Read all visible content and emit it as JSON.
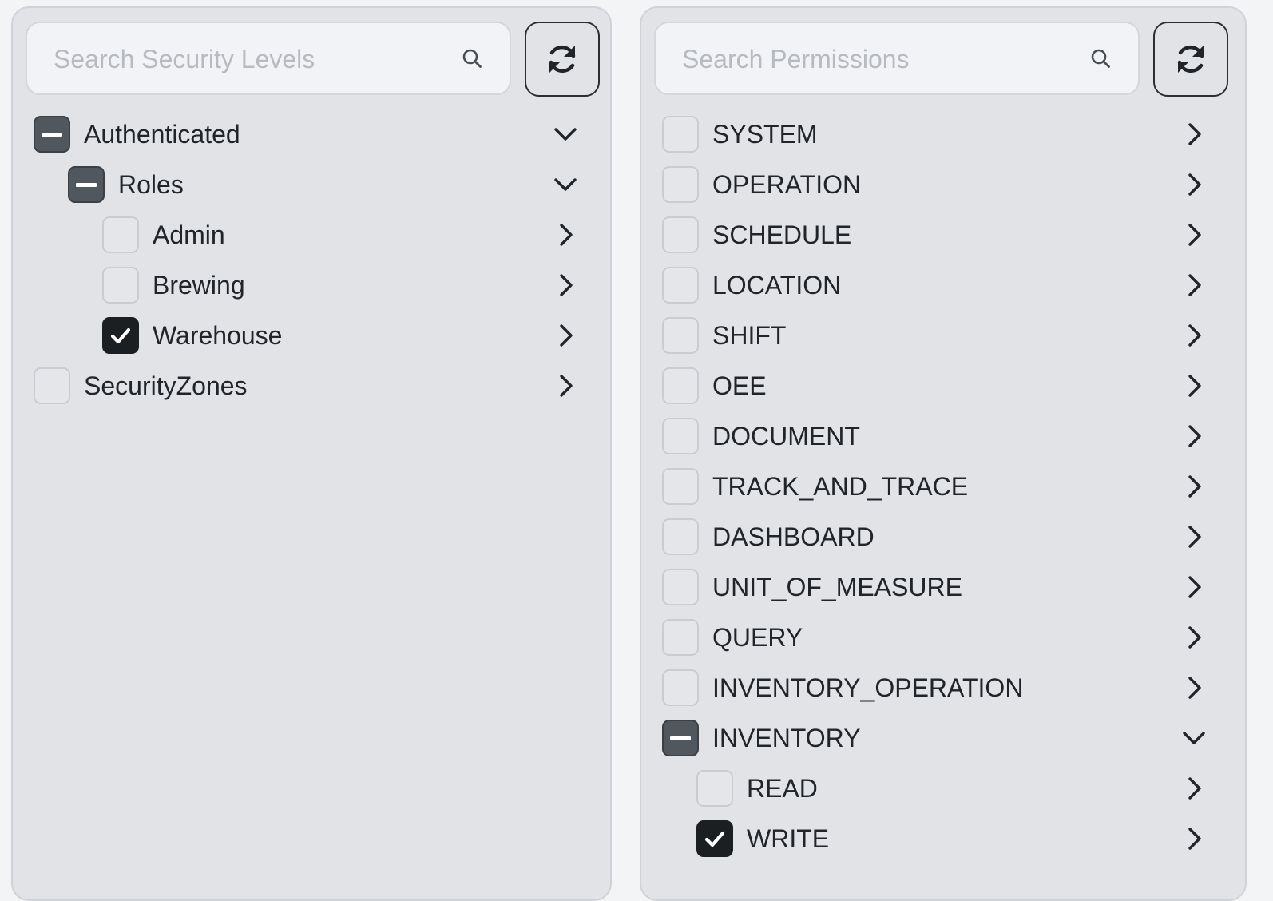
{
  "left_panel": {
    "search_placeholder": "Search Security Levels",
    "search_value": "",
    "items": [
      {
        "label": "Authenticated",
        "state": "partial",
        "expanded": true,
        "level": 0
      },
      {
        "label": "Roles",
        "state": "partial",
        "expanded": true,
        "level": 1
      },
      {
        "label": "Admin",
        "state": "unchecked",
        "expanded": false,
        "level": 2
      },
      {
        "label": "Brewing",
        "state": "unchecked",
        "expanded": false,
        "level": 2
      },
      {
        "label": "Warehouse",
        "state": "checked",
        "expanded": false,
        "level": 2
      },
      {
        "label": "SecurityZones",
        "state": "unchecked",
        "expanded": false,
        "level": 0
      }
    ]
  },
  "right_panel": {
    "search_placeholder": "Search Permissions",
    "search_value": "",
    "items": [
      {
        "label": "SYSTEM",
        "state": "unchecked",
        "expanded": false,
        "level": 0
      },
      {
        "label": "OPERATION",
        "state": "unchecked",
        "expanded": false,
        "level": 0
      },
      {
        "label": "SCHEDULE",
        "state": "unchecked",
        "expanded": false,
        "level": 0
      },
      {
        "label": "LOCATION",
        "state": "unchecked",
        "expanded": false,
        "level": 0
      },
      {
        "label": "SHIFT",
        "state": "unchecked",
        "expanded": false,
        "level": 0
      },
      {
        "label": "OEE",
        "state": "unchecked",
        "expanded": false,
        "level": 0
      },
      {
        "label": "DOCUMENT",
        "state": "unchecked",
        "expanded": false,
        "level": 0
      },
      {
        "label": "TRACK_AND_TRACE",
        "state": "unchecked",
        "expanded": false,
        "level": 0
      },
      {
        "label": "DASHBOARD",
        "state": "unchecked",
        "expanded": false,
        "level": 0
      },
      {
        "label": "UNIT_OF_MEASURE",
        "state": "unchecked",
        "expanded": false,
        "level": 0
      },
      {
        "label": "QUERY",
        "state": "unchecked",
        "expanded": false,
        "level": 0
      },
      {
        "label": "INVENTORY_OPERATION",
        "state": "unchecked",
        "expanded": false,
        "level": 0
      },
      {
        "label": "INVENTORY",
        "state": "partial",
        "expanded": true,
        "level": 0
      },
      {
        "label": "READ",
        "state": "unchecked",
        "expanded": false,
        "level": 1
      },
      {
        "label": "WRITE",
        "state": "checked",
        "expanded": false,
        "level": 1
      }
    ]
  },
  "icons": {
    "search": "search-icon",
    "refresh": "refresh-icon",
    "expanded": "chevron-down-icon",
    "collapsed": "chevron-right-icon",
    "checked": "checkmark-icon",
    "partial": "minus-icon"
  },
  "colors": {
    "panel_bg": "#e1e3e7",
    "checkbox_checked": "#1c1f22",
    "checkbox_partial": "#51575d",
    "text": "#212529",
    "placeholder": "#b7bbc0"
  }
}
